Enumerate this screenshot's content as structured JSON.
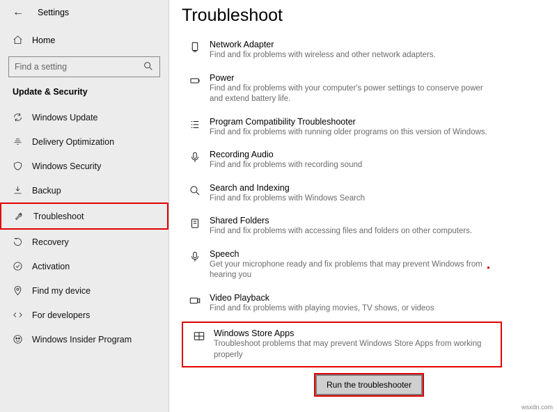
{
  "sidebar": {
    "app_title": "Settings",
    "home_label": "Home",
    "search_placeholder": "Find a setting",
    "category": "Update & Security",
    "items": [
      {
        "label": "Windows Update"
      },
      {
        "label": "Delivery Optimization"
      },
      {
        "label": "Windows Security"
      },
      {
        "label": "Backup"
      },
      {
        "label": "Troubleshoot",
        "highlighted": true
      },
      {
        "label": "Recovery"
      },
      {
        "label": "Activation"
      },
      {
        "label": "Find my device"
      },
      {
        "label": "For developers"
      },
      {
        "label": "Windows Insider Program"
      }
    ]
  },
  "main": {
    "title": "Troubleshoot",
    "run_button": "Run the troubleshooter",
    "ts": [
      {
        "title": "Network Adapter",
        "desc": "Find and fix problems with wireless and other network adapters."
      },
      {
        "title": "Power",
        "desc": "Find and fix problems with your computer's power settings to conserve power and extend battery life."
      },
      {
        "title": "Program Compatibility Troubleshooter",
        "desc": "Find and fix problems with running older programs on this version of Windows."
      },
      {
        "title": "Recording Audio",
        "desc": "Find and fix problems with recording sound"
      },
      {
        "title": "Search and Indexing",
        "desc": "Find and fix problems with Windows Search"
      },
      {
        "title": "Shared Folders",
        "desc": "Find and fix problems with accessing files and folders on other computers."
      },
      {
        "title": "Speech",
        "desc": "Get your microphone ready and fix problems that may prevent Windows from hearing you"
      },
      {
        "title": "Video Playback",
        "desc": "Find and fix problems with playing movies, TV shows, or videos"
      },
      {
        "title": "Windows Store Apps",
        "desc": "Troubleshoot problems that may prevent Windows Store Apps from working properly",
        "highlighted": true
      }
    ]
  },
  "footer_watermark": "wsxdn.com"
}
